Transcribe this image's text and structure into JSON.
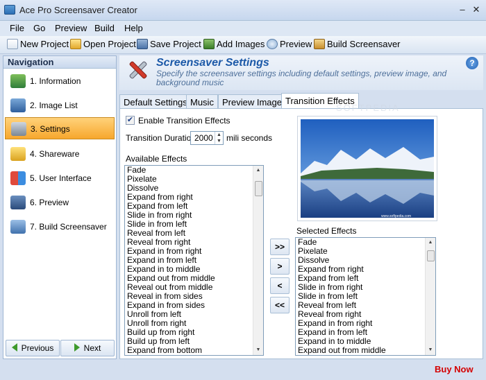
{
  "window": {
    "title": "Ace Pro Screensaver Creator",
    "minimize": "–",
    "close": "✕"
  },
  "menu": [
    "File",
    "Go",
    "Preview",
    "Build",
    "Help"
  ],
  "toolbar": {
    "new_project": "New Project",
    "open_project": "Open Project",
    "save_project": "Save Project",
    "add_images": "Add Images",
    "preview": "Preview",
    "build_screensaver": "Build Screensaver"
  },
  "nav": {
    "title": "Navigation",
    "items": [
      {
        "label": "1. Information",
        "icon": "information-icon"
      },
      {
        "label": "2. Image List",
        "icon": "image-list-icon"
      },
      {
        "label": "3. Settings",
        "icon": "settings-tools-icon",
        "active": true
      },
      {
        "label": "4. Shareware",
        "icon": "lock-icon"
      },
      {
        "label": "5. User Interface",
        "icon": "user-interface-icon"
      },
      {
        "label": "6. Preview",
        "icon": "preview-film-icon"
      },
      {
        "label": "7. Build Screensaver",
        "icon": "build-icon"
      }
    ],
    "previous": "Previous",
    "next": "Next"
  },
  "header": {
    "title": "Screensaver Settings",
    "description": "Specify the screensaver settings including default settings, preview image, and background music",
    "help": "?"
  },
  "tabs": [
    "Default Settings",
    "Music",
    "Preview Image",
    "Transition Effects"
  ],
  "active_tab": "Transition Effects",
  "transition": {
    "enable_label": "Enable Transition Effects",
    "enabled": true,
    "duration_label": "Transition Duration",
    "duration_value": "2000",
    "duration_unit": "mili seconds",
    "available_label": "Available Effects",
    "selected_label": "Selected Effects",
    "available": [
      "Fade",
      "Pixelate",
      "Dissolve",
      "Expand from right",
      "Expand from left",
      "Slide in from right",
      "Slide in from left",
      "Reveal from left",
      "Reveal from right",
      "Expand in from right",
      "Expand in from left",
      "Expand in to middle",
      "Expand out from middle",
      "Reveal out from middle",
      "Reveal in from sides",
      "Expand in from sides",
      "Unroll from left",
      "Unroll from right",
      "Build up from right",
      "Build up from left",
      "Expand from bottom"
    ],
    "selected": [
      "Fade",
      "Pixelate",
      "Dissolve",
      "Expand from right",
      "Expand from left",
      "Slide in from right",
      "Slide in from left",
      "Reveal from left",
      "Reveal from right",
      "Expand in from right",
      "Expand in from left",
      "Expand in to middle",
      "Expand out from middle"
    ],
    "buttons": {
      "add_all": ">>",
      "add": ">",
      "remove": "<",
      "remove_all": "<<"
    },
    "preview_caption": "SOFTPEDIA",
    "preview_watermark": "www.softpedia.com"
  },
  "status": {
    "buy_now": "Buy Now"
  },
  "colors": {
    "accent": "#1c59a8",
    "active_nav": "#f7a72d",
    "buy_now": "#d40000"
  }
}
